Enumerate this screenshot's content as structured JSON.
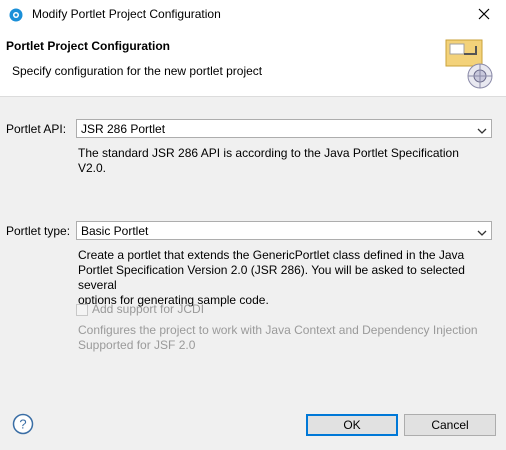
{
  "window": {
    "title": "Modify Portlet Project Configuration"
  },
  "header": {
    "title": "Portlet Project Configuration",
    "description": "Specify configuration for the new portlet project"
  },
  "portlet_api": {
    "label": "Portlet API:",
    "value": "JSR 286 Portlet",
    "description": "The standard JSR 286 API is according to the Java Portlet Specification V2.0."
  },
  "portlet_type": {
    "label": "Portlet type:",
    "value": "Basic Portlet",
    "description_lines": [
      "Create a portlet that extends the GenericPortlet class defined in the Java",
      "Portlet Specification Version 2.0 (JSR 286).  You will be asked to selected several",
      "options for generating sample code."
    ]
  },
  "jcdi": {
    "checkbox_label": "Add support for JCDI",
    "checked": false,
    "enabled": false,
    "description_lines": [
      "Configures the project to work with Java Context and Dependency Injection",
      "Supported for JSF 2.0"
    ]
  },
  "buttons": {
    "ok": "OK",
    "cancel": "Cancel"
  },
  "icons": {
    "app": "eclipse-icon",
    "close": "close-icon",
    "banner": "wizard-banner-icon",
    "help": "help-icon",
    "dropdown": "chevron-down-icon"
  },
  "colors": {
    "focus_border": "#0078d7",
    "disabled_text": "#9a9a9a"
  }
}
